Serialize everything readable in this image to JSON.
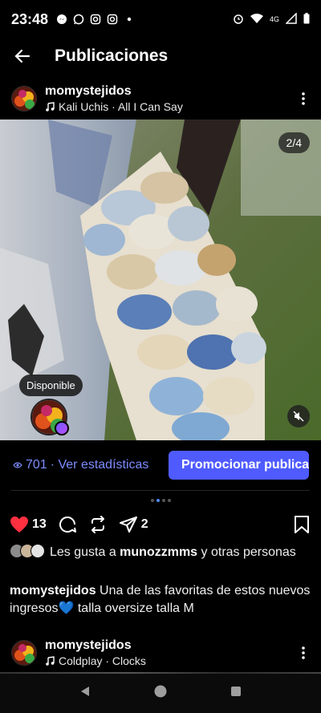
{
  "status_bar": {
    "time": "23:48",
    "left_icons": [
      "messenger-icon",
      "whatsapp-icon",
      "instagram-icon",
      "instagram-icon",
      "dot-icon"
    ],
    "network": "4G",
    "right_icons": [
      "alarm-icon",
      "wifi-icon",
      "signal-icon",
      "battery-icon"
    ]
  },
  "app_bar": {
    "title": "Publicaciones",
    "back_icon": "arrow-left-icon"
  },
  "post": {
    "username": "momystejidos",
    "music": "Kali Uchis · All I Can Say",
    "music_icon": "music-note-icon",
    "media_counter": "2/4",
    "availability_label": "Disponible",
    "mute_icon": "muted-speaker-icon",
    "views": "701",
    "stats_link": "· Ver estadísticas",
    "promote_button": "Promocionar publicación",
    "carousel": {
      "total": 4,
      "active_index": 1
    },
    "likes_count": "13",
    "shares_count": "2",
    "liked_by_prefix": "Les gusta a ",
    "liked_by_user": "munozzmms",
    "liked_by_suffix": " y otras personas",
    "caption_user": "momystejidos",
    "caption_text": " Una de las favoritas de estos nuevos ingresos💙 talla oversize talla M"
  },
  "next_post": {
    "username": "momystejidos",
    "music": "Coldplay · Clocks"
  },
  "colors": {
    "background": "#000000",
    "accent": "#4f5bff",
    "link": "#7c8cff",
    "like": "#ff3040"
  },
  "nav": [
    "back-triangle-icon",
    "home-circle-icon",
    "recents-square-icon"
  ]
}
